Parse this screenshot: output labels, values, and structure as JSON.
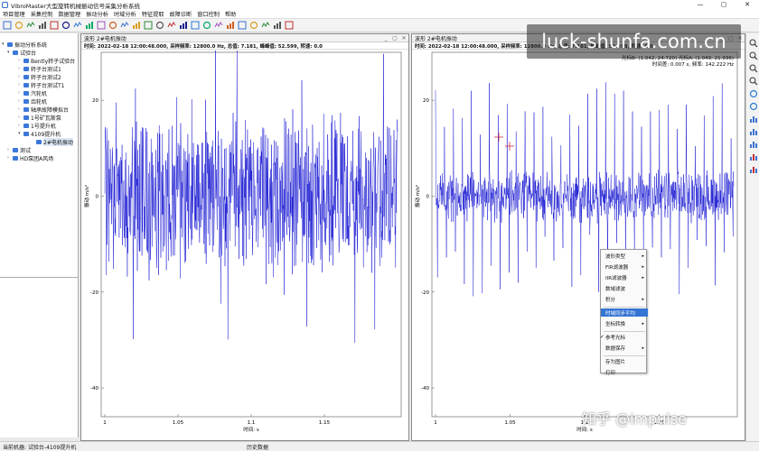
{
  "window": {
    "title": "VibroMaster大型旋转机械振动信号采集分析系统",
    "minimize": "—",
    "maximize": "▢",
    "close": "✕"
  },
  "menu": [
    "项目管理",
    "采集控制",
    "数据管理",
    "振动分析",
    "时域分析",
    "特征提取",
    "故障诊断",
    "窗口控制",
    "帮助"
  ],
  "toolbar": {
    "icons": [
      "new-icon",
      "open-icon",
      "save-icon",
      "print-icon",
      "settings-icon",
      "record-icon",
      "ring-icon",
      "waveform-icon",
      "spectrum-icon",
      "trend-icon",
      "orbit-icon",
      "bode-icon",
      "polar-icon",
      "cascade-icon",
      "waterfall-icon",
      "filter-icon",
      "zoom-icon",
      "cursor-icon",
      "colormap-icon",
      "chart-icon",
      "signal-icon",
      "export-icon",
      "grid-icon",
      "image-icon",
      "info-icon"
    ]
  },
  "tree": {
    "items": [
      "振动分析系统",
      "试验台",
      "Bently转子试验台",
      "转子台测试1",
      "转子台测试2",
      "转子台测试T1",
      "汽轮机",
      "齿轮机",
      "轴承故障模拟台",
      "1号矿瓦斯泵",
      "1号提升机",
      "4109提升机",
      "2#电机振动",
      "测试",
      "HD泵团A风场"
    ]
  },
  "panel_left": {
    "title": "波形  2#电机振动",
    "info": "时间: 2022-02-18 12:00:48.000, 采样频率: 12800.0 Hz, 总值: 7.181, 峰峰值: 52.599, 转速: 0.0",
    "xlabel": "时间: s",
    "ylabel": "振动 m/s²",
    "x_ticks": [
      "1",
      "1.05",
      "1.1",
      "1.15"
    ],
    "y_ticks": [
      "20",
      "0",
      "-20",
      "-40"
    ]
  },
  "panel_right": {
    "title": "波形  2#电机振动",
    "info": "时间: 2022-02-18 12:00:48.000, 采样频率: 12800.0 Hz, 总值: 7.181, 峰峰值: 52.599, 转速: 0.0",
    "cursor_a": "光标B: (1.042, 24.720)  光标A: (1.049, 21.936)",
    "cursor_b": "时间差: 0.007 s, 频率: 142.222 Hz",
    "xlabel": "时间: s",
    "ylabel": "振动 m/s²",
    "x_ticks": [
      "1",
      "1.05",
      "1.1",
      "1.15"
    ],
    "y_ticks": [
      "20",
      "0",
      "-20",
      "-40"
    ]
  },
  "context_menu": {
    "items": [
      {
        "label": "波形类型",
        "sub": true
      },
      {
        "label": "FIR滤波器",
        "sub": true
      },
      {
        "label": "IIR滤波器",
        "sub": true
      },
      {
        "label": "数域滤波",
        "sub": false
      },
      {
        "label": "积分",
        "sub": true
      },
      {
        "label": "时域同步平均",
        "sub": false,
        "highlight": true
      },
      {
        "label": "坐标转换",
        "sub": true
      },
      {
        "label": "参考光标",
        "sub": false,
        "checked": true
      },
      {
        "label": "数据保存",
        "sub": true
      },
      {
        "label": "存为图片",
        "sub": false
      },
      {
        "label": "打印",
        "sub": false
      }
    ]
  },
  "right_toolbar": [
    "zoom-in-icon",
    "zoom-out-icon",
    "cursor-icon",
    "pan-icon",
    "circle-icon",
    "circle-icon",
    "bar-chart-icon",
    "bar-chart-icon",
    "bar-chart-icon",
    "bar-chart-icon",
    "bar-chart-icon"
  ],
  "status": {
    "left": "当前机器: 试验台-4109提升机",
    "mid": "历史数据"
  },
  "watermark": {
    "text": "luck-shunfa.com.cn",
    "text2": "知乎 @impulse"
  },
  "colors": {
    "signal": "#1010d0",
    "highlight": "#3474d4",
    "cursor": "#cc3344"
  }
}
